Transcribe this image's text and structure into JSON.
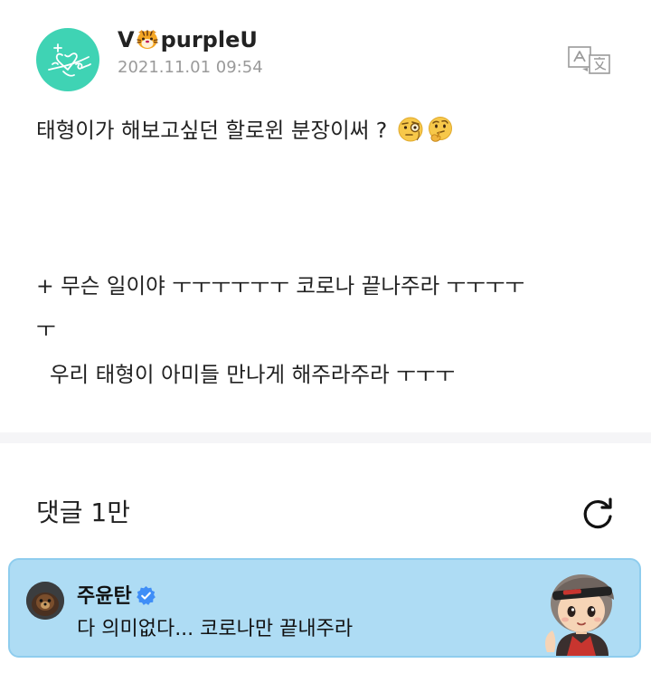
{
  "post": {
    "author": {
      "name_prefix": "V",
      "name_suffix": "purpleU",
      "name_emoji": "tiger-face-icon",
      "avatar": "signature-avatar-icon",
      "avatar_color": "#3fd3b4"
    },
    "date": "2021.11.01 09:54",
    "translate_icon": "translate-icon",
    "body": {
      "line1": "태형이가 해보고싶던 할로윈 분장이써 ?",
      "line1_emojis": [
        "face-with-monocle-icon",
        "thinking-face-icon"
      ],
      "line2": "+ 무슨 일이야 ㅜㅜㅜㅜㅜㅜ 코로나 끝나주라 ㅜㅜㅜㅜ",
      "line3": "ㅜ",
      "line4": "  우리 태형이 아미들 만나게 해주라주라 ㅜㅜㅜ"
    }
  },
  "comments": {
    "count_label": "댓글 1만",
    "refresh_icon": "refresh-icon",
    "highlighted": {
      "author": "주윤탄",
      "verified_icon": "verified-badge-icon",
      "text": "다 의미없다... 코로나만 끝내주라",
      "sticker": "character-sticker-icon",
      "bg_color": "#aedcf4",
      "badge_color": "#3f8ef7"
    }
  }
}
